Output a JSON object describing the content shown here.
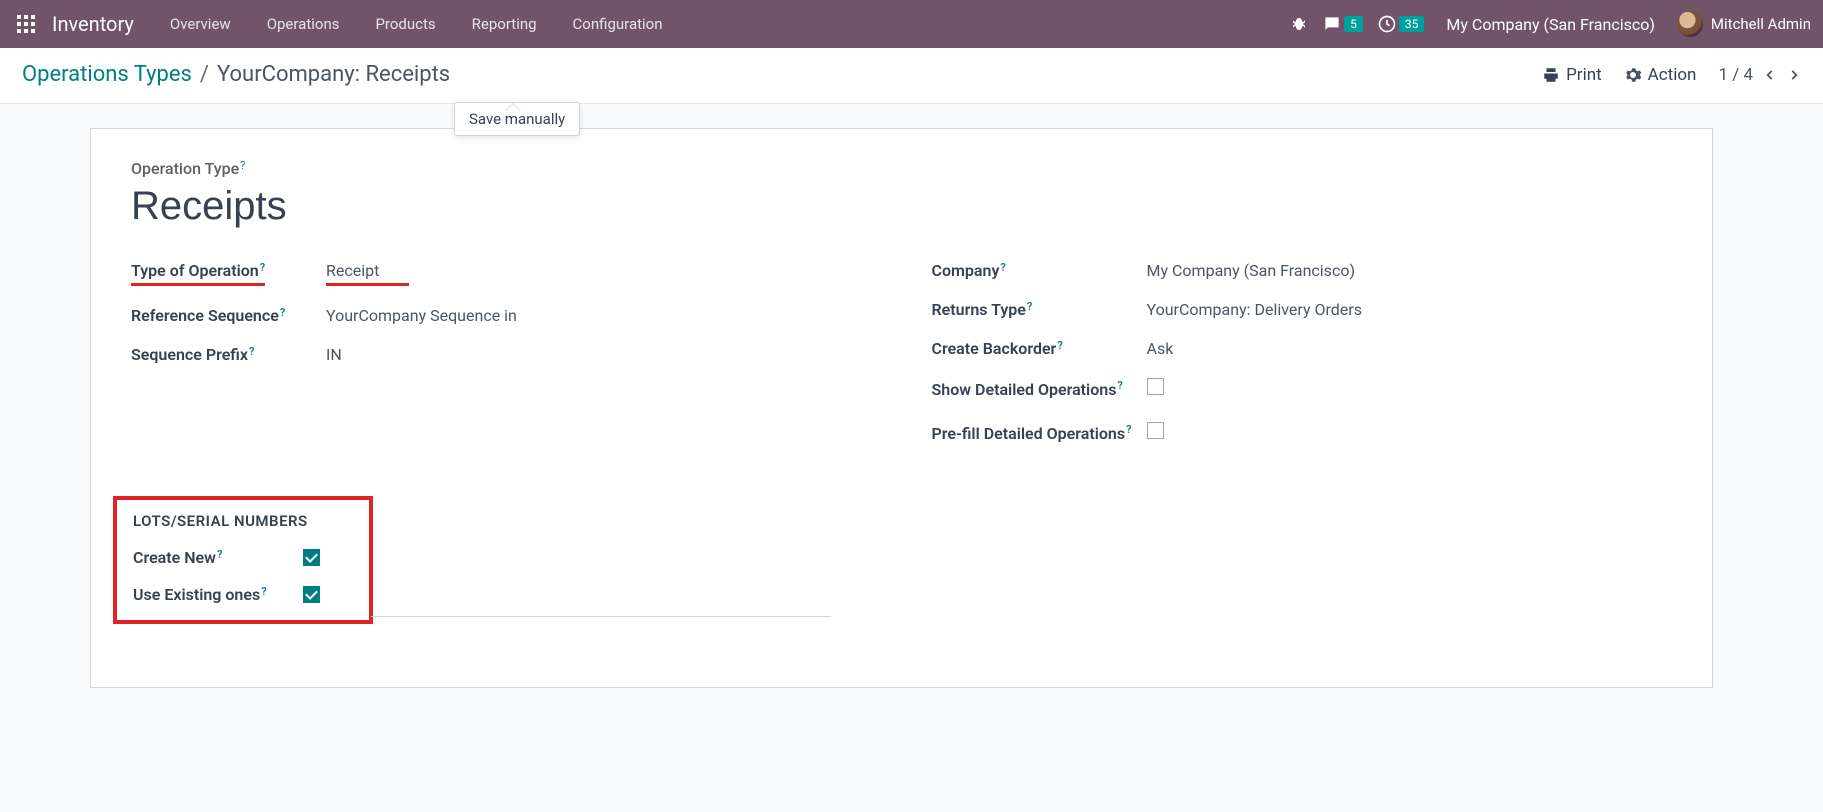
{
  "navbar": {
    "brand": "Inventory",
    "menu": [
      "Overview",
      "Operations",
      "Products",
      "Reporting",
      "Configuration"
    ],
    "messages_badge": "5",
    "activities_badge": "35",
    "company": "My Company (San Francisco)",
    "user": "Mitchell Admin"
  },
  "controlbar": {
    "breadcrumb_link": "Operations Types",
    "breadcrumb_sep": "/",
    "breadcrumb_current": "YourCompany: Receipts",
    "print": "Print",
    "action": "Action",
    "pager": "1 / 4",
    "tooltip": "Save manually"
  },
  "form": {
    "op_type_label": "Operation Type",
    "name": "Receipts",
    "left": {
      "type_of_operation_label": "Type of Operation",
      "type_of_operation_value": "Receipt",
      "reference_sequence_label": "Reference Sequence",
      "reference_sequence_value": "YourCompany Sequence in",
      "sequence_prefix_label": "Sequence Prefix",
      "sequence_prefix_value": "IN"
    },
    "right": {
      "company_label": "Company",
      "company_value": "My Company (San Francisco)",
      "returns_type_label": "Returns Type",
      "returns_type_value": "YourCompany: Delivery Orders",
      "create_backorder_label": "Create Backorder",
      "create_backorder_value": "Ask",
      "show_detailed_label": "Show Detailed Operations",
      "prefill_label": "Pre-fill Detailed Operations"
    },
    "lots": {
      "section": "LOTS/SERIAL NUMBERS",
      "create_new": "Create New",
      "use_existing": "Use Existing ones"
    }
  }
}
